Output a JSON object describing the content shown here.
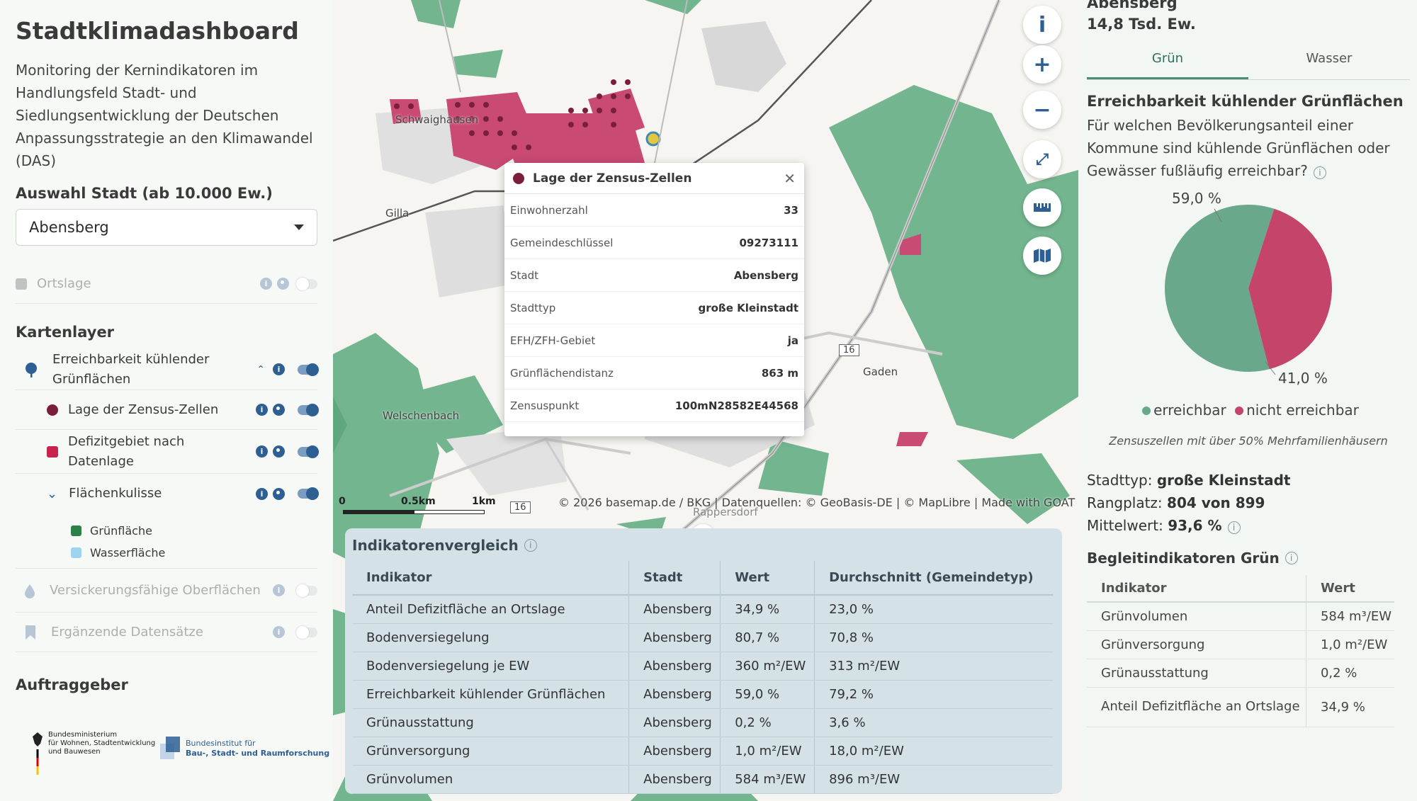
{
  "left": {
    "title": "Stadtklimadashboard",
    "description": "Monitoring der Kernindikatoren im Handlungsfeld Stadt- und Siedlungsentwicklung der Deutschen Anpassungsstrategie an den Klimawandel (DAS)",
    "city_label": "Auswahl Stadt (ab 10.000 Ew.)",
    "city_value": "Abensberg",
    "ortslage": "Ortslage",
    "kartenlayer_title": "Kartenlayer",
    "layers": {
      "main": "Erreichbarkeit kühlender Grünflächen",
      "zensus": "Lage der Zensus-Zellen",
      "defizit": "Defizitgebiet nach Datenlage",
      "flaeche": "Flächenkulisse",
      "gruen": "Grünfläche",
      "wasser": "Wasserfläche",
      "versick": "Versickerungsfähige Oberflächen",
      "ergaenz": "Ergänzende Datensätze"
    },
    "auftraggeber_title": "Auftraggeber",
    "logo1": [
      "Bundesministerium",
      "für Wohnen, Stadtentwicklung",
      "und Bauwesen"
    ],
    "logo2": [
      "Bundesinstitut für",
      "Bau-, Stadt- und Raumforschung"
    ]
  },
  "map": {
    "places": {
      "schwaighausen": "Schwaighausen",
      "gilla": "Gilla",
      "welschenbach": "Welschenbach",
      "gaden": "Gaden",
      "rappersdorf": "Rappersdorf",
      "road16": "16",
      "road16b": "16"
    },
    "attribution": "© 2026 basemap.de / BKG | Datenquellen: © GeoBasis-DE | © MapLibre | Made with GOAT",
    "scale": [
      "0",
      "0.5km",
      "1km"
    ]
  },
  "popup": {
    "title": "Lage der Zensus-Zellen",
    "rows": [
      {
        "k": "Einwohnerzahl",
        "v": "33"
      },
      {
        "k": "Gemeindeschlüssel",
        "v": "09273111"
      },
      {
        "k": "Stadt",
        "v": "Abensberg"
      },
      {
        "k": "Stadttyp",
        "v": "große Kleinstadt"
      },
      {
        "k": "EFH/ZFH-Gebiet",
        "v": "ja"
      },
      {
        "k": "Grünflächendistanz",
        "v": "863 m"
      },
      {
        "k": "Zensuspunkt",
        "v": "100mN28582E44568"
      }
    ]
  },
  "indicators": {
    "title": "Indikatorenvergleich",
    "headers": [
      "Indikator",
      "Stadt",
      "Wert",
      "Durchschnitt (Gemeindetyp)"
    ],
    "rows": [
      [
        "Anteil Defizitfläche an Ortslage",
        "Abensberg",
        "34,9 %",
        "23,0 %"
      ],
      [
        "Bodenversiegelung",
        "Abensberg",
        "80,7 %",
        "70,8 %"
      ],
      [
        "Bodenversiegelung je EW",
        "Abensberg",
        "360 m²/EW",
        "313 m²/EW"
      ],
      [
        "Erreichbarkeit kühlender Grünflächen",
        "Abensberg",
        "59,0 %",
        "79,2 %"
      ],
      [
        "Grünausstattung",
        "Abensberg",
        "0,2 %",
        "3,6 %"
      ],
      [
        "Grünversorgung",
        "Abensberg",
        "1,0 m²/EW",
        "18,0 m²/EW"
      ],
      [
        "Grünvolumen",
        "Abensberg",
        "584 m³/EW",
        "896 m³/EW"
      ]
    ]
  },
  "right": {
    "city": "Abensberg",
    "population": "14,8 Tsd. Ew.",
    "tabs": [
      "Grün",
      "Wasser"
    ],
    "heading": "Erreichbarkeit kühlender Grünflächen",
    "question": "Für welchen Bevölkerungsanteil einer Kommune sind kühlende Grünflächen oder Gewässer fußläufig erreichbar?",
    "legend_a": "erreichbar",
    "legend_b": "nicht erreichbar",
    "note": "Zensuszellen mit über 50% Mehrfamilienhäusern",
    "stadttyp_label": "Stadttyp:",
    "stadttyp": "große Kleinstadt",
    "rang_label": "Rangplatz:",
    "rang": "804 von 899",
    "mittel_label": "Mittelwert:",
    "mittel": "93,6 %",
    "begleit_title": "Begleitindikatoren Grün",
    "table_headers": [
      "Indikator",
      "Wert"
    ],
    "table_rows": [
      [
        "Grünvolumen",
        "584 m³/EW"
      ],
      [
        "Grünversorgung",
        "1,0 m²/EW"
      ],
      [
        "Grünausstattung",
        "0,2 %"
      ],
      [
        "Anteil Defizitfläche an Ortslage",
        "34,9 %"
      ]
    ]
  },
  "chart_data": {
    "type": "pie",
    "categories": [
      "erreichbar",
      "nicht erreichbar"
    ],
    "values": [
      59.0,
      41.0
    ],
    "labels": [
      "59,0 %",
      "41,0 %"
    ],
    "colors": [
      "#6aa88c",
      "#c5456a"
    ]
  },
  "colors": {
    "accent": "#2d5f92",
    "green": "#6aa88c",
    "red": "#c5456a",
    "zensus": "#7a1f3a",
    "defizit": "#c8234d",
    "gruenflaeche": "#2e8049",
    "wasserflaeche": "#9fd4ef"
  }
}
